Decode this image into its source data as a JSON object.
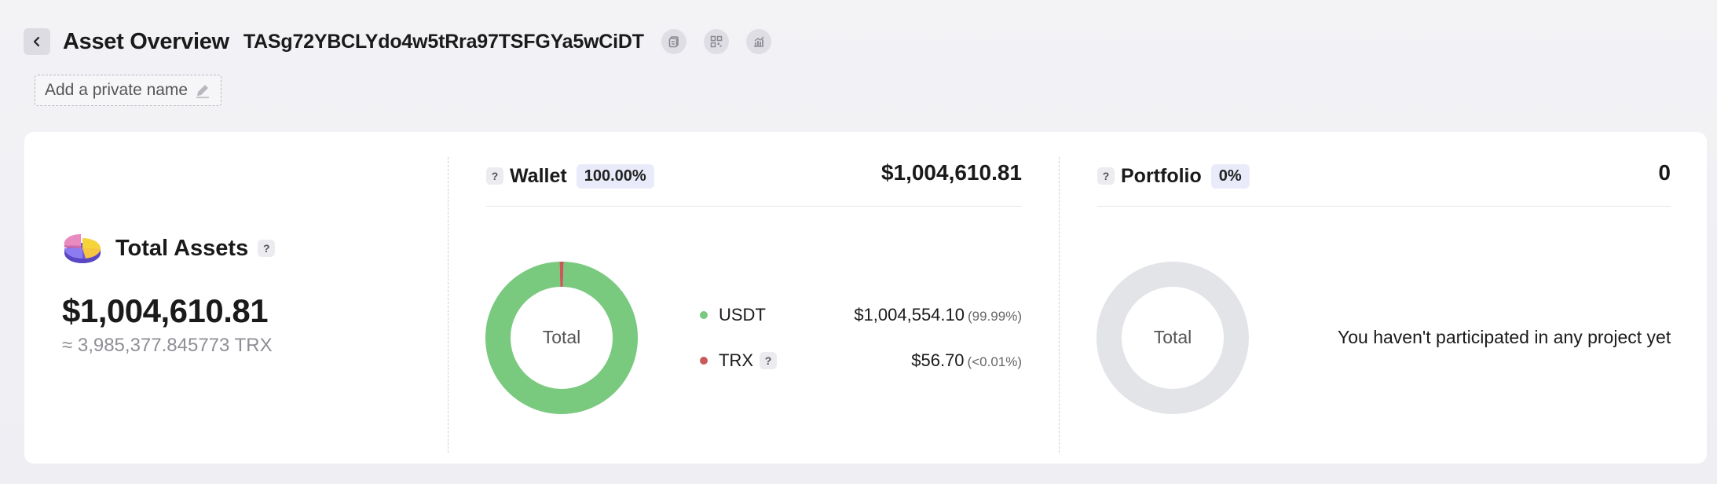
{
  "header": {
    "title": "Asset Overview",
    "address": "TASg72YBCLYdo4w5tRra97TSFGYa5wCiDT",
    "icons": [
      "copy-icon",
      "qr-code-icon",
      "chart-icon"
    ]
  },
  "private_name": {
    "label": "Add a private name"
  },
  "total_assets": {
    "label": "Total Assets",
    "help": "?",
    "value": "$1,004,610.81",
    "trx": "≈ 3,985,377.845773 TRX"
  },
  "wallet": {
    "help": "?",
    "title": "Wallet",
    "percent": "100.00%",
    "amount": "$1,004,610.81",
    "donut_label": "Total",
    "items": [
      {
        "symbol": "USDT",
        "value": "$1,004,554.10",
        "percent": "(99.99%)",
        "share": 99.99,
        "color": "#79c97e"
      },
      {
        "symbol": "TRX",
        "help": "?",
        "value": "$56.70",
        "percent": "(<0.01%)",
        "share": 0.01,
        "color": "#c85a5a"
      }
    ]
  },
  "portfolio": {
    "help": "?",
    "title": "Portfolio",
    "percent": "0%",
    "amount": "0",
    "donut_label": "Total",
    "empty_message": "You haven't participated in any project yet",
    "donut_color": "#e3e4e8"
  }
}
